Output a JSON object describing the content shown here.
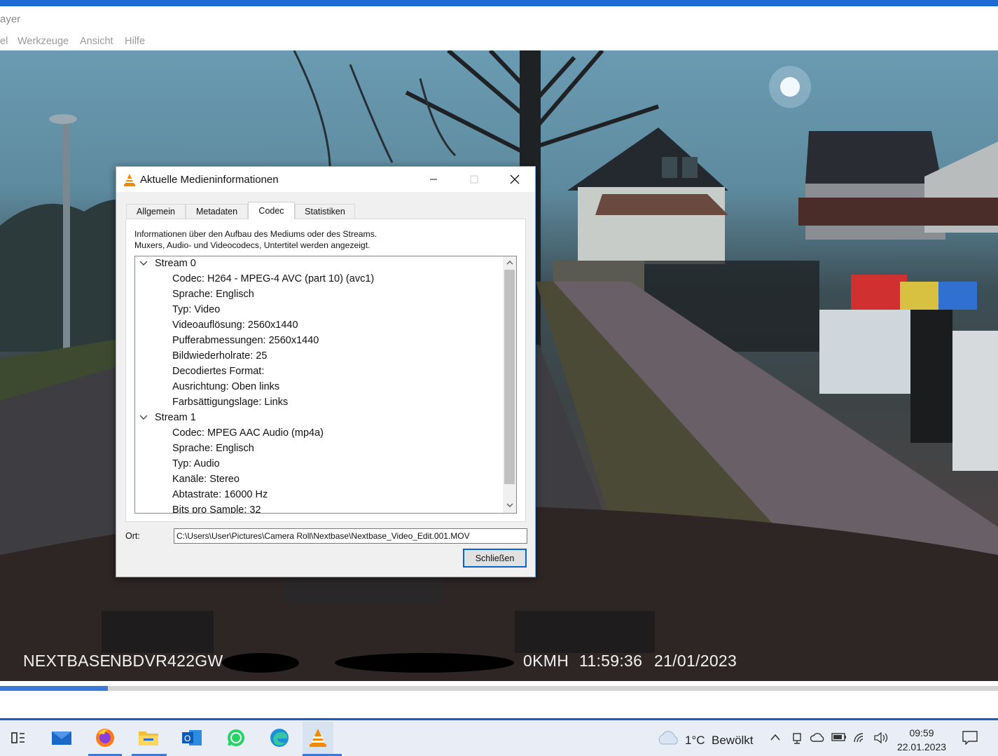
{
  "window": {
    "title_fragment": "ayer",
    "menu": [
      "el",
      "Werkzeuge",
      "Ansicht",
      "Hilfe"
    ]
  },
  "video_osd": {
    "brand": "NEXTBASE",
    "model": "NBDVR422GW",
    "speed": "0KMH",
    "time": "11:59:36",
    "date": "21/01/2023"
  },
  "seek": {
    "progress": 0.108
  },
  "dialog": {
    "title": "Aktuelle Medieninformationen",
    "controls": {
      "minimize": "—",
      "maximize": "☐",
      "close": "✕"
    },
    "tabs": [
      "Allgemein",
      "Metadaten",
      "Codec",
      "Statistiken"
    ],
    "active_tab": "Codec",
    "description_line1": "Informationen über den Aufbau des Mediums oder des Streams.",
    "description_line2": "Muxers, Audio- und Videocodecs, Untertitel werden angezeigt.",
    "streams": [
      {
        "label": "Stream 0",
        "items": [
          "Codec: H264 - MPEG-4 AVC (part 10) (avc1)",
          "Sprache: Englisch",
          "Typ: Video",
          "Videoauflösung: 2560x1440",
          "Pufferabmessungen: 2560x1440",
          "Bildwiederholrate: 25",
          "Decodiertes Format:",
          "Ausrichtung: Oben links",
          "Farbsättigungslage: Links"
        ]
      },
      {
        "label": "Stream 1",
        "items": [
          "Codec: MPEG AAC Audio (mp4a)",
          "Sprache: Englisch",
          "Typ: Audio",
          "Kanäle: Stereo",
          "Abtastrate: 16000 Hz",
          "Bits pro Sample: 32"
        ]
      }
    ],
    "location_label": "Ort:",
    "location_value": "C:\\Users\\User\\Pictures\\Camera Roll\\Nextbase\\Nextbase_Video_Edit.001.MOV",
    "close_button": "Schließen"
  },
  "taskbar": {
    "apps": [
      "task-view",
      "mail",
      "firefox",
      "file-explorer",
      "outlook",
      "whatsapp",
      "edge",
      "vlc"
    ],
    "weather": {
      "temp": "1°C",
      "condition": "Bewölkt"
    },
    "clock": {
      "time": "09:59",
      "date": "22.01.2023"
    }
  }
}
